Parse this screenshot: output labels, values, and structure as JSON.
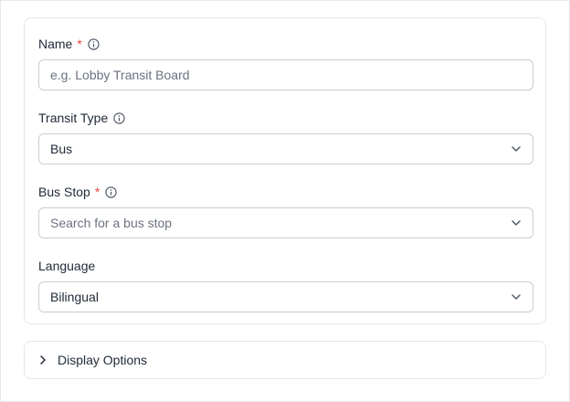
{
  "form": {
    "name": {
      "label": "Name",
      "required_mark": "*",
      "placeholder": "e.g. Lobby Transit Board",
      "value": ""
    },
    "transit_type": {
      "label": "Transit Type",
      "selected": "Bus"
    },
    "bus_stop": {
      "label": "Bus Stop",
      "required_mark": "*",
      "placeholder": "Search for a bus stop"
    },
    "language": {
      "label": "Language",
      "selected": "Bilingual"
    }
  },
  "display_options": {
    "title": "Display Options",
    "expanded": false
  },
  "colors": {
    "required": "#ef4444",
    "border": "#c9ccd1",
    "text": "#1f2937",
    "placeholder": "#6b7280"
  },
  "icons": {
    "info": "info-circle-icon",
    "dropdown": "chevron-down-icon",
    "expand": "chevron-right-icon"
  }
}
